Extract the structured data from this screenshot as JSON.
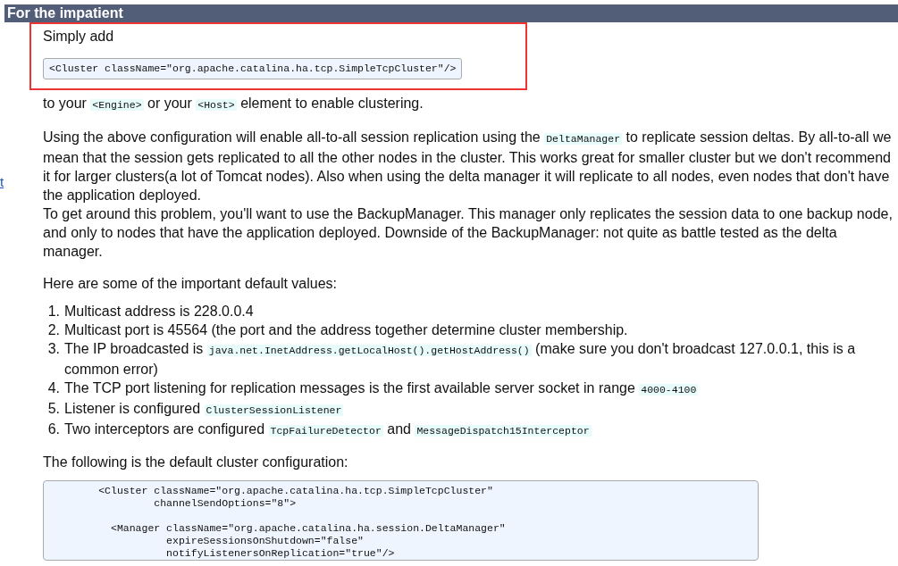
{
  "side_link": "t",
  "section": {
    "title": "For the impatient"
  },
  "highlight": {
    "intro": "Simply add",
    "code": "<Cluster className=\"org.apache.catalina.ha.tcp.SimpleTcpCluster\"/>"
  },
  "blocks": [
    {
      "segments": [
        {
          "kind": "text",
          "text": "to your "
        },
        {
          "kind": "code",
          "text": "<Engine>"
        },
        {
          "kind": "text",
          "text": " or your "
        },
        {
          "kind": "code",
          "text": "<Host>"
        },
        {
          "kind": "text",
          "text": " element to enable clustering."
        }
      ]
    },
    {
      "segments": [
        {
          "kind": "text",
          "text": "Using the above configuration will enable all-to-all session replication using the "
        },
        {
          "kind": "code",
          "text": "DeltaManager"
        },
        {
          "kind": "text",
          "text": " to replicate session deltas. By all-to-all we mean that the session gets replicated to all the other nodes in the cluster. This works great for smaller cluster but we don't recommend it for larger clusters(a lot of Tomcat nodes). Also when using the delta manager it will replicate to all nodes, even nodes that don't have the application deployed."
        },
        {
          "kind": "break"
        },
        {
          "kind": "text",
          "text": "To get around this problem, you'll want to use the BackupManager. This manager only replicates the session data to one backup node, and only to nodes that have the application deployed. Downside of the BackupManager: not quite as battle tested as the delta manager."
        }
      ]
    },
    {
      "segments": [
        {
          "kind": "text",
          "text": "Here are some of the important default values:"
        }
      ]
    }
  ],
  "list": [
    {
      "number": "1.",
      "segments": [
        {
          "kind": "text",
          "text": "Multicast address is 228.0.0.4"
        }
      ]
    },
    {
      "number": "2.",
      "segments": [
        {
          "kind": "text",
          "text": "Multicast port is 45564 (the port and the address together determine cluster membership."
        }
      ]
    },
    {
      "number": "3.",
      "segments": [
        {
          "kind": "text",
          "text": "The IP broadcasted is "
        },
        {
          "kind": "code",
          "text": "java.net.InetAddress.getLocalHost().getHostAddress()"
        },
        {
          "kind": "text",
          "text": " (make sure you don't broadcast 127.0.0.1, this is a common error)"
        }
      ]
    },
    {
      "number": "4.",
      "segments": [
        {
          "kind": "text",
          "text": "The TCP port listening for replication messages is the first available server socket in range "
        },
        {
          "kind": "code",
          "text": "4000-4100"
        }
      ]
    },
    {
      "number": "5.",
      "segments": [
        {
          "kind": "text",
          "text": "Listener is configured "
        },
        {
          "kind": "code",
          "text": "ClusterSessionListener"
        }
      ]
    },
    {
      "number": "6.",
      "segments": [
        {
          "kind": "text",
          "text": "Two interceptors are configured "
        },
        {
          "kind": "code",
          "text": "TcpFailureDetector"
        },
        {
          "kind": "text",
          "text": " and "
        },
        {
          "kind": "code",
          "text": "MessageDispatch15Interceptor"
        }
      ]
    }
  ],
  "closing": "The following is the default cluster configuration:",
  "code_block": "        <Cluster className=\"org.apache.catalina.ha.tcp.SimpleTcpCluster\"\n                 channelSendOptions=\"8\">\n\n          <Manager className=\"org.apache.catalina.ha.session.DeltaManager\"\n                   expireSessionsOnShutdown=\"false\"\n                   notifyListenersOnReplication=\"true\"/>"
}
